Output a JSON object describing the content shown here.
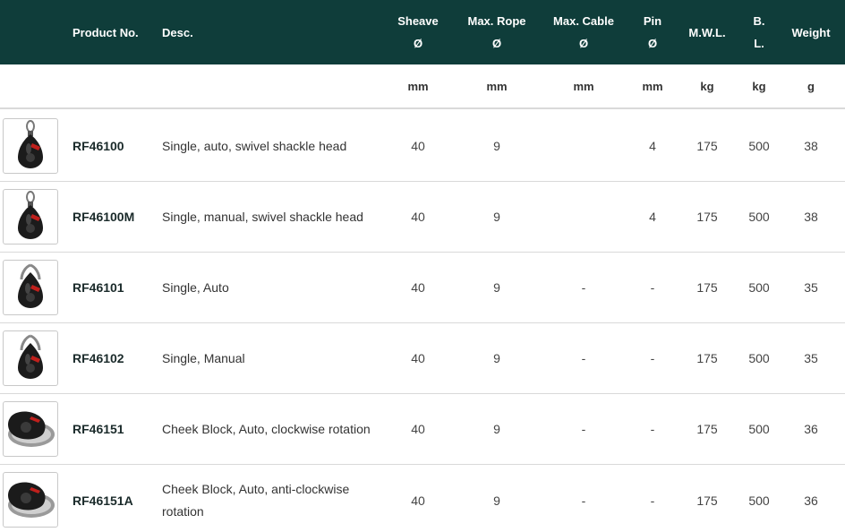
{
  "header": {
    "product_no": "Product No.",
    "desc": "Desc.",
    "sheave": [
      "Sheave",
      "Ø"
    ],
    "max_rope": [
      "Max. Rope",
      "Ø"
    ],
    "max_cable": [
      "Max. Cable",
      "Ø"
    ],
    "pin": [
      "Pin",
      "Ø"
    ],
    "mwl": "M.W.L.",
    "bl": [
      "B.",
      "L."
    ],
    "weight": "Weight"
  },
  "units": {
    "sheave": "mm",
    "max_rope": "mm",
    "max_cable": "mm",
    "pin": "mm",
    "mwl": "kg",
    "bl": "kg",
    "weight": "g"
  },
  "rows": [
    {
      "product_no": "RF46100",
      "desc": "Single, auto, swivel shackle head",
      "sheave": "40",
      "max_rope": "9",
      "max_cable": "",
      "pin": "4",
      "mwl": "175",
      "bl": "500",
      "weight": "38",
      "image": "single-block-swivel-shackle-image"
    },
    {
      "product_no": "RF46100M",
      "desc": "Single, manual, swivel shackle head",
      "sheave": "40",
      "max_rope": "9",
      "max_cable": "",
      "pin": "4",
      "mwl": "175",
      "bl": "500",
      "weight": "38",
      "image": "single-block-swivel-shackle-image"
    },
    {
      "product_no": "RF46101",
      "desc": "Single, Auto",
      "sheave": "40",
      "max_rope": "9",
      "max_cable": "-",
      "pin": "-",
      "mwl": "175",
      "bl": "500",
      "weight": "35",
      "image": "single-block-image"
    },
    {
      "product_no": "RF46102",
      "desc": "Single, Manual",
      "sheave": "40",
      "max_rope": "9",
      "max_cable": "-",
      "pin": "-",
      "mwl": "175",
      "bl": "500",
      "weight": "35",
      "image": "single-block-image"
    },
    {
      "product_no": "RF46151",
      "desc": "Cheek Block, Auto, clockwise rotation",
      "sheave": "40",
      "max_rope": "9",
      "max_cable": "-",
      "pin": "-",
      "mwl": "175",
      "bl": "500",
      "weight": "36",
      "image": "cheek-block-image"
    },
    {
      "product_no": "RF46151A",
      "desc": "Cheek Block, Auto, anti-clockwise rotation",
      "sheave": "40",
      "max_rope": "9",
      "max_cable": "-",
      "pin": "-",
      "mwl": "175",
      "bl": "500",
      "weight": "36",
      "image": "cheek-block-image"
    }
  ],
  "colors": {
    "header_bg": "#0f3d3a",
    "header_text": "#ffffff",
    "divider": "#d9d9d9",
    "accent_red": "#c0201c"
  }
}
